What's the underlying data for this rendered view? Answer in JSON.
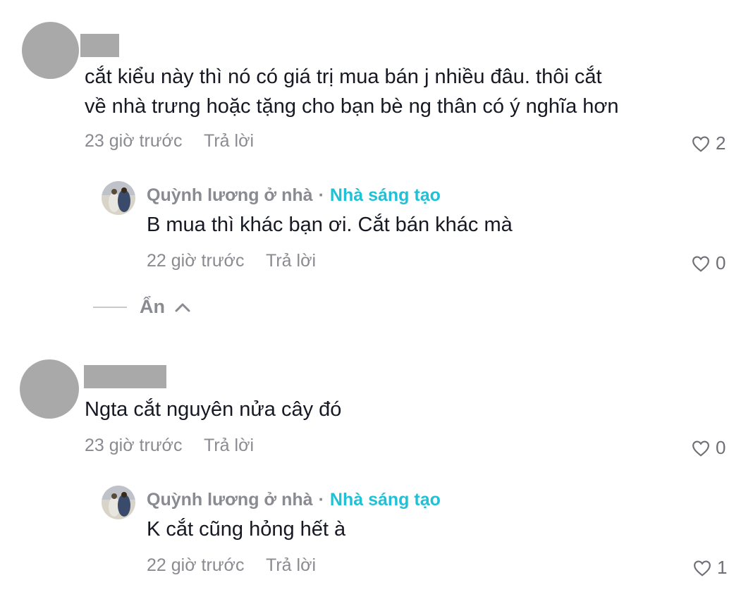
{
  "comments": [
    {
      "text_line1": "cắt kiểu này thì nó có giá trị mua bán j nhiều đâu. thôi cắt",
      "text_line2": "về nhà trưng hoặc tặng cho bạn bè ng thân có ý nghĩa hơn",
      "time": "23 giờ trước",
      "reply_label": "Trả lời",
      "likes": "2",
      "replies": [
        {
          "author": "Quỳnh lương ở nhà",
          "separator": "·",
          "badge": "Nhà sáng tạo",
          "text": "B mua thì khác bạn ơi. Cắt bán khác mà",
          "time": "22 giờ trước",
          "reply_label": "Trả lời",
          "likes": "0"
        }
      ],
      "hide_label": "Ẩn"
    },
    {
      "text_line1": "Ngta cắt nguyên nửa cây đó",
      "time": "23 giờ trước",
      "reply_label": "Trả lời",
      "likes": "0",
      "replies": [
        {
          "author": "Quỳnh lương ở nhà",
          "separator": "·",
          "badge": "Nhà sáng tạo",
          "text": "K cắt cũng hỏng hết à",
          "time": "22 giờ trước",
          "reply_label": "Trả lời",
          "likes": "1"
        }
      ]
    }
  ],
  "colors": {
    "creator_badge": "#20c1d6",
    "meta_text": "#8a8b91",
    "placeholder_gray": "#a9a9a9"
  },
  "icons": {
    "like": "heart-outline-icon",
    "collapse": "chevron-up-icon"
  }
}
